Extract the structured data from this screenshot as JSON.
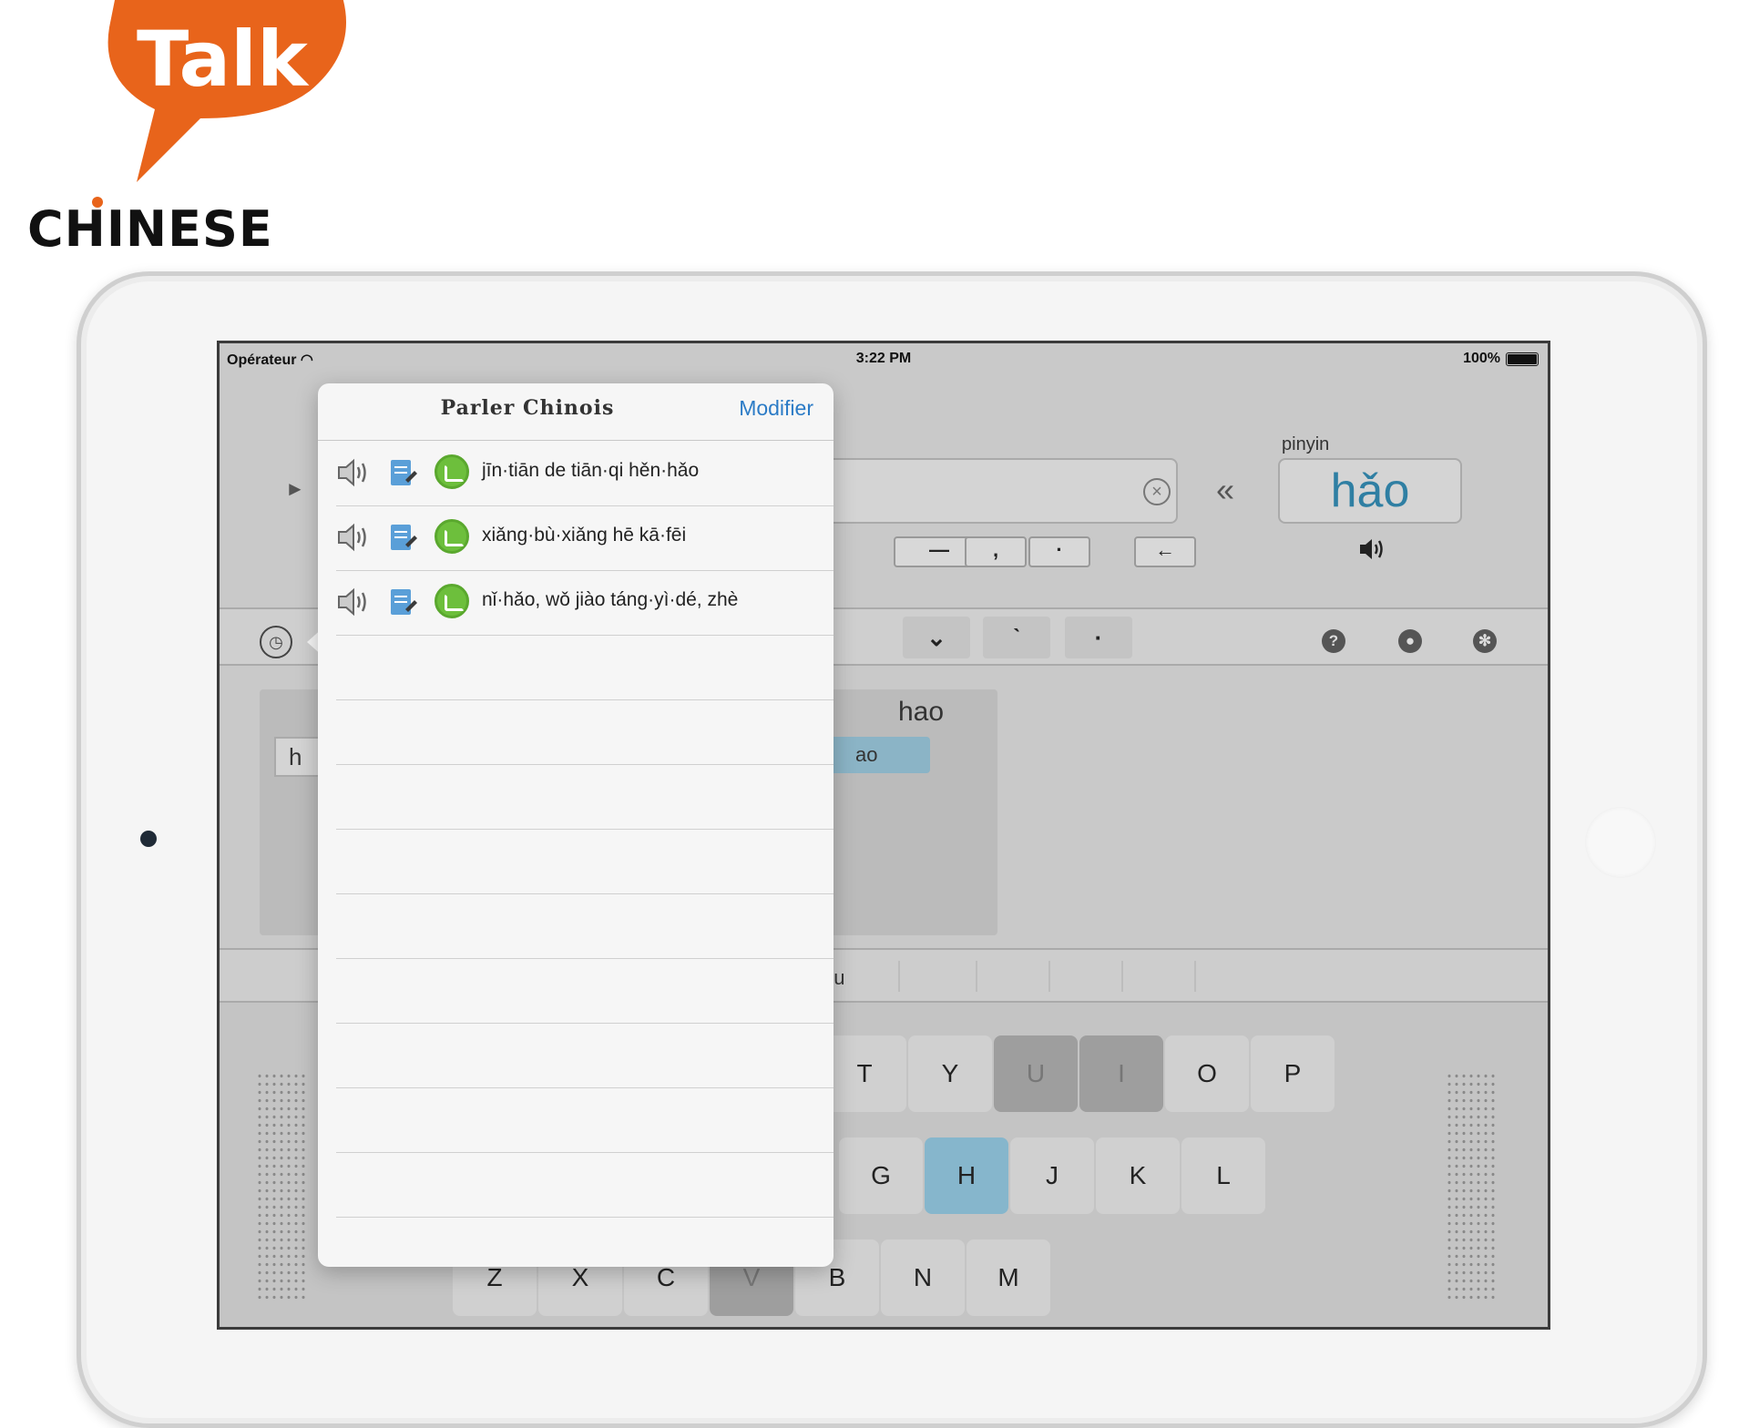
{
  "logo": {
    "word1": "Talk",
    "word2": "CHINESE",
    "brand_color": "#e8641b"
  },
  "status_bar": {
    "carrier": "Opérateur",
    "time": "3:22 PM",
    "battery": "100%"
  },
  "input": {
    "play_icon": "►",
    "back_icon": "«",
    "pinyin_label": "pinyin",
    "pinyin_value": "hǎo",
    "punct_buttons": [
      "—",
      ",",
      "·",
      "←"
    ]
  },
  "tone_bar": {
    "tones": [
      "⌄",
      "ˋ",
      "·"
    ]
  },
  "candidates": {
    "left_input": "h",
    "title": "hao",
    "chip": "ao"
  },
  "suggestions": {
    "text": "hu"
  },
  "keyboard": {
    "row1": [
      "T",
      "Y",
      "U",
      "I",
      "O",
      "P"
    ],
    "row2": [
      "G",
      "H",
      "J",
      "K",
      "L"
    ],
    "row3": [
      "Z",
      "X",
      "C",
      "V",
      "B",
      "N",
      "M"
    ]
  },
  "popover": {
    "title": "Parler Chinois",
    "edit_label": "Modifier",
    "phrases": [
      "jīn·tiān de tiān·qi hěn·hǎo",
      "xiǎng·bù·xiǎng hē kā·fēi",
      "nǐ·hǎo, wǒ jiào táng·yì·dé, zhè"
    ]
  }
}
